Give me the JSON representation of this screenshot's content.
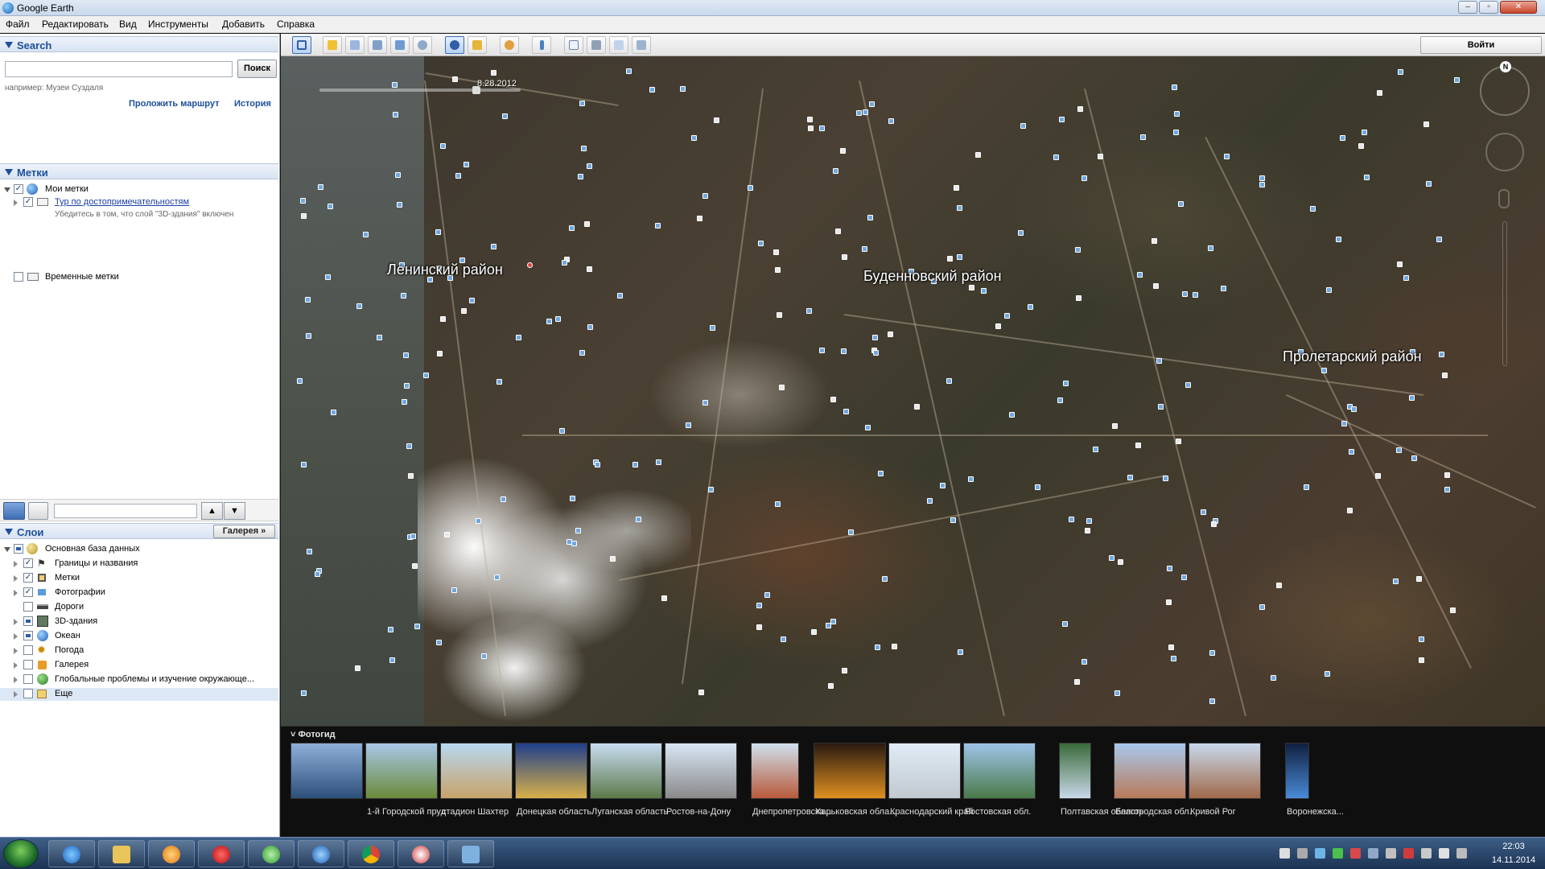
{
  "window": {
    "title": "Google Earth"
  },
  "menu": [
    "Файл",
    "Редактировать",
    "Вид",
    "Инструменты",
    "Добавить",
    "Справка"
  ],
  "search": {
    "header": "Search",
    "value": "",
    "button": "Поиск",
    "hint": "например: Музеи Суздаля",
    "route_link": "Проложить маршрут",
    "history_link": "История"
  },
  "places": {
    "header": "Метки",
    "items": [
      {
        "label": "Мои метки",
        "checked": true
      },
      {
        "label": "Тур по достопримечательностям",
        "checked": true,
        "sub": "Убедитесь в том, что слой \"3D-здания\" включен"
      },
      {
        "label": "Временные метки",
        "checked": false
      }
    ]
  },
  "layers": {
    "header": "Слои",
    "gallery_button": "Галерея",
    "items": [
      {
        "label": "Основная база данных",
        "state": "partial"
      },
      {
        "label": "Границы и названия",
        "state": "checked"
      },
      {
        "label": "Метки",
        "state": "checked"
      },
      {
        "label": "Фотографии",
        "state": "checked"
      },
      {
        "label": "Дороги",
        "state": "unchecked"
      },
      {
        "label": "3D-здания",
        "state": "partial"
      },
      {
        "label": "Океан",
        "state": "partial"
      },
      {
        "label": "Погода",
        "state": "unchecked"
      },
      {
        "label": "Галерея",
        "state": "unchecked"
      },
      {
        "label": "Глобальные проблемы и изучение окружающе...",
        "state": "unchecked"
      },
      {
        "label": "Еще",
        "state": "unchecked"
      }
    ]
  },
  "toolbar": {
    "login": "Войти"
  },
  "map": {
    "date": "8.28.2012",
    "compass_north": "N",
    "labels": [
      "Ленинский район",
      "Буденновский район",
      "Пролетарский район"
    ]
  },
  "photostrip": {
    "header": "Фотогид",
    "photos": [
      {
        "caption": ""
      },
      {
        "caption": "1-й Городской пруд"
      },
      {
        "caption": "стадион Шахтер"
      },
      {
        "caption": "Донецкая область"
      },
      {
        "caption": "Луганская область"
      },
      {
        "caption": "Ростов-на-Дону"
      },
      {
        "caption": "Днепропетровска..."
      },
      {
        "caption": "Харьковская обла..."
      },
      {
        "caption": "Краснодарский край"
      },
      {
        "caption": "Ростовская обл."
      },
      {
        "caption": "Полтавская область"
      },
      {
        "caption": "Белгородская обл."
      },
      {
        "caption": "Кривой Рог"
      },
      {
        "caption": "Воронежска..."
      }
    ]
  },
  "taskbar": {
    "time": "22:03",
    "date": "14.11.2014"
  }
}
